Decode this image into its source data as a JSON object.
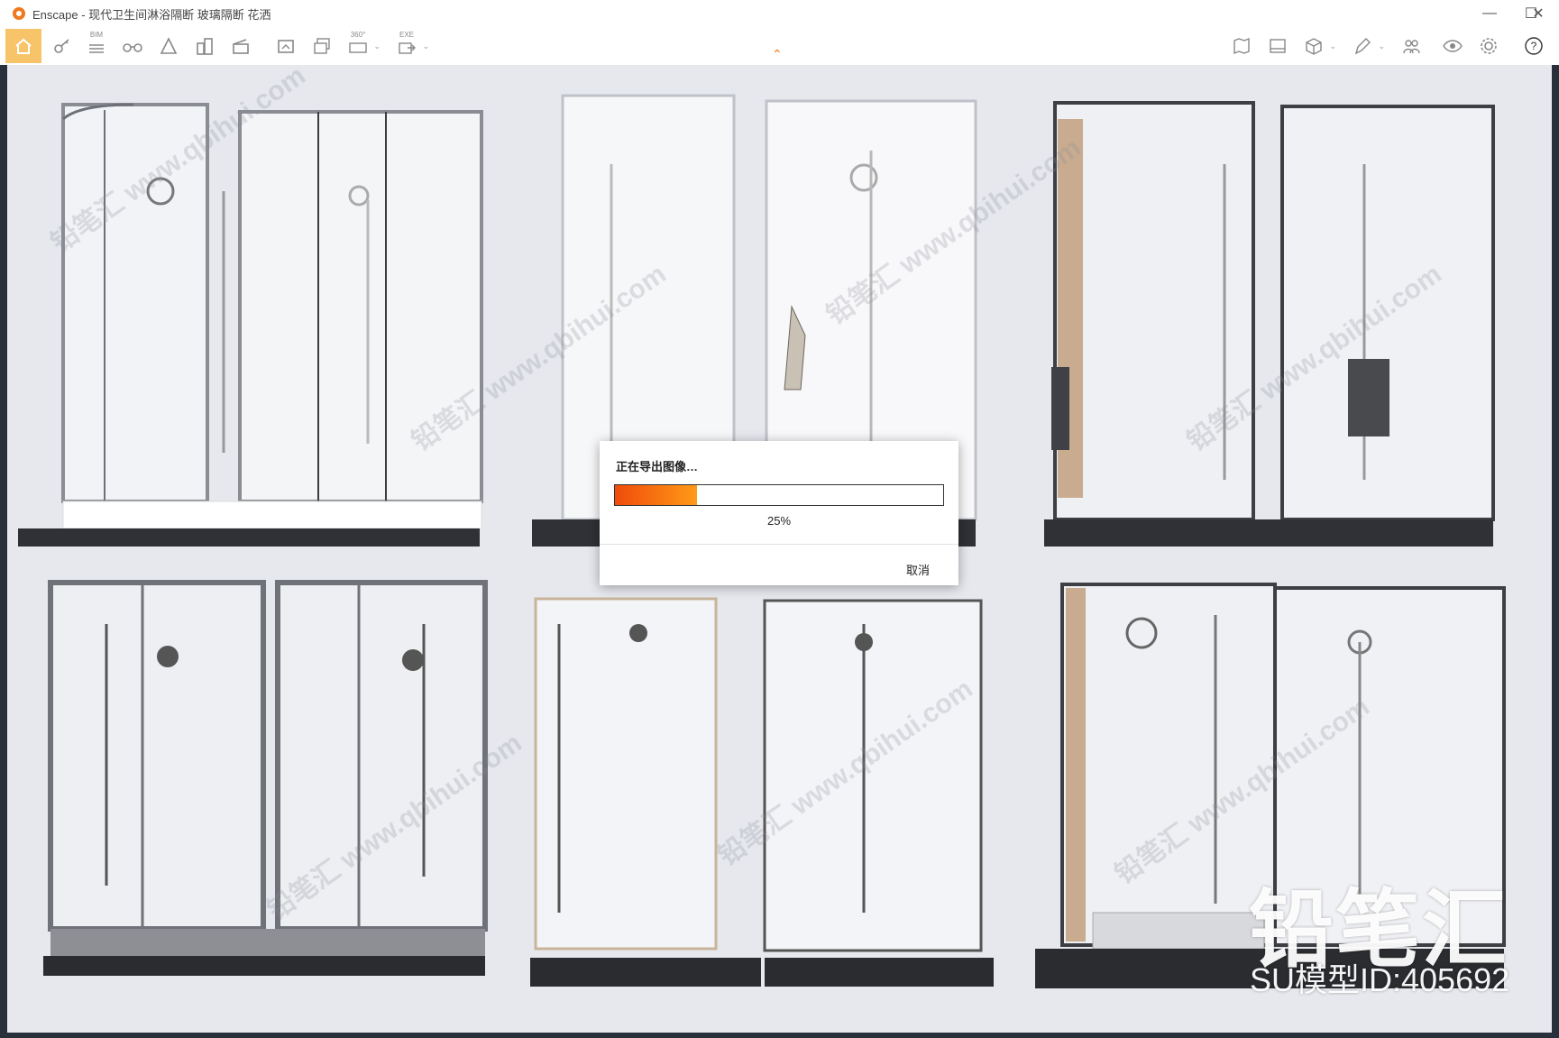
{
  "window": {
    "title": "Enscape - 现代卫生间淋浴隔断 玻璃隔断 花洒",
    "controls": {
      "minimize": "—",
      "maximize": "☐",
      "close": "✕"
    }
  },
  "toolbar": {
    "left_items": [
      {
        "icon": "home-icon",
        "active": true
      },
      {
        "icon": "key-icon"
      },
      {
        "icon": "bim-icon",
        "sub": "BIM"
      },
      {
        "icon": "binoculars-icon"
      },
      {
        "icon": "road-sign-icon"
      },
      {
        "icon": "buildings-icon"
      },
      {
        "icon": "clapperboard-icon"
      },
      {
        "icon": "screenshot-icon"
      },
      {
        "icon": "batch-render-icon"
      },
      {
        "icon": "panorama-360-icon",
        "sub": "360°"
      },
      {
        "icon": "export-exe-icon",
        "sub": "EXE"
      }
    ],
    "right_items": [
      {
        "icon": "map-icon"
      },
      {
        "icon": "gallery-icon"
      },
      {
        "icon": "cube-icon"
      },
      {
        "icon": "pen-icon"
      },
      {
        "icon": "people-icon"
      },
      {
        "icon": "eye-icon"
      },
      {
        "icon": "gear-icon"
      },
      {
        "icon": "help-icon",
        "label": "?"
      }
    ],
    "collapse_glyph": "⌃"
  },
  "export_dialog": {
    "title": "正在导出图像…",
    "progress": 0.25,
    "percent_label": "25%",
    "cancel_label": "取消"
  },
  "overlay": {
    "brand": "铅笔汇",
    "model_id": "SU模型ID:405692",
    "watermarks": [
      "铅笔汇 www.qbihui.com"
    ]
  },
  "colors": {
    "accent": "#f0781e",
    "active_tab": "#f7c46a",
    "viewport_bg": "#e6e8ee",
    "progress_start": "#f04b0a",
    "progress_end": "#ff9a18"
  }
}
